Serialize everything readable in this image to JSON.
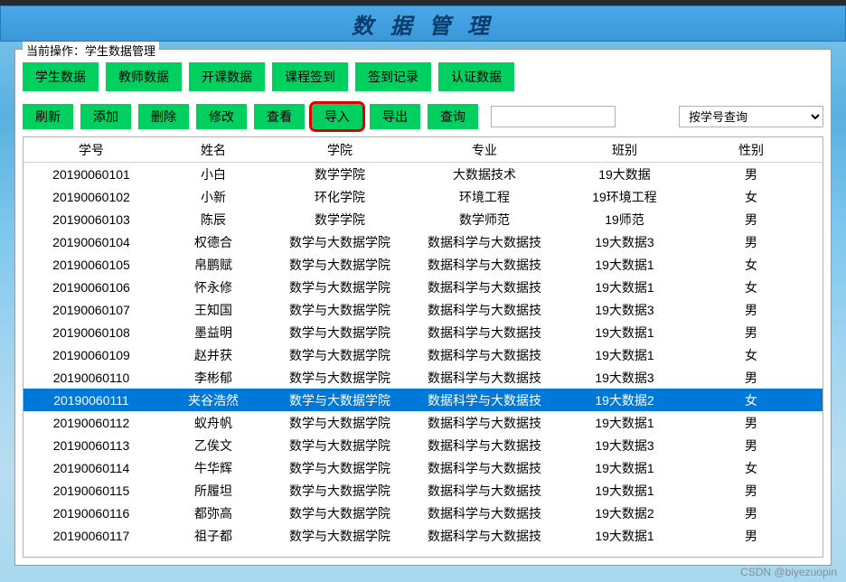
{
  "title": "数 据 管 理",
  "fieldset_label": "当前操作：学生数据管理",
  "top_buttons": [
    "学生数据",
    "教师数据",
    "开课数据",
    "课程签到",
    "签到记录",
    "认证数据"
  ],
  "action_buttons": [
    "刷新",
    "添加",
    "删除",
    "修改",
    "查看",
    "导入",
    "导出",
    "查询"
  ],
  "highlighted_action_index": 5,
  "search_value": "",
  "select_options": [
    "按学号查询"
  ],
  "select_value": "按学号查询",
  "columns": [
    "学号",
    "姓名",
    "学院",
    "专业",
    "班别",
    "性别"
  ],
  "selected_row_index": 10,
  "rows": [
    [
      "20190060101",
      "小白",
      "数学学院",
      "大数据技术",
      "19大数据",
      "男"
    ],
    [
      "20190060102",
      "小新",
      "环化学院",
      "环境工程",
      "19环境工程",
      "女"
    ],
    [
      "20190060103",
      "陈辰",
      "数学学院",
      "数学师范",
      "19师范",
      "男"
    ],
    [
      "20190060104",
      "权德合",
      "数学与大数据学院",
      "数据科学与大数据技",
      "19大数据3",
      "男"
    ],
    [
      "20190060105",
      "帛鹏赋",
      "数学与大数据学院",
      "数据科学与大数据技",
      "19大数据1",
      "女"
    ],
    [
      "20190060106",
      "怀永修",
      "数学与大数据学院",
      "数据科学与大数据技",
      "19大数据1",
      "女"
    ],
    [
      "20190060107",
      "王知国",
      "数学与大数据学院",
      "数据科学与大数据技",
      "19大数据3",
      "男"
    ],
    [
      "20190060108",
      "墨益明",
      "数学与大数据学院",
      "数据科学与大数据技",
      "19大数据1",
      "男"
    ],
    [
      "20190060109",
      "赵并获",
      "数学与大数据学院",
      "数据科学与大数据技",
      "19大数据1",
      "女"
    ],
    [
      "20190060110",
      "李彬郁",
      "数学与大数据学院",
      "数据科学与大数据技",
      "19大数据3",
      "男"
    ],
    [
      "20190060111",
      "夹谷浩然",
      "数学与大数据学院",
      "数据科学与大数据技",
      "19大数据2",
      "女"
    ],
    [
      "20190060112",
      "蚁舟帆",
      "数学与大数据学院",
      "数据科学与大数据技",
      "19大数据1",
      "男"
    ],
    [
      "20190060113",
      "乙俟文",
      "数学与大数据学院",
      "数据科学与大数据技",
      "19大数据3",
      "男"
    ],
    [
      "20190060114",
      "牛华辉",
      "数学与大数据学院",
      "数据科学与大数据技",
      "19大数据1",
      "女"
    ],
    [
      "20190060115",
      "所履坦",
      "数学与大数据学院",
      "数据科学与大数据技",
      "19大数据1",
      "男"
    ],
    [
      "20190060116",
      "都弥高",
      "数学与大数据学院",
      "数据科学与大数据技",
      "19大数据2",
      "男"
    ],
    [
      "20190060117",
      "祖子都",
      "数学与大数据学院",
      "数据科学与大数据技",
      "19大数据1",
      "男"
    ]
  ],
  "watermark": "CSDN @biyezuopin"
}
